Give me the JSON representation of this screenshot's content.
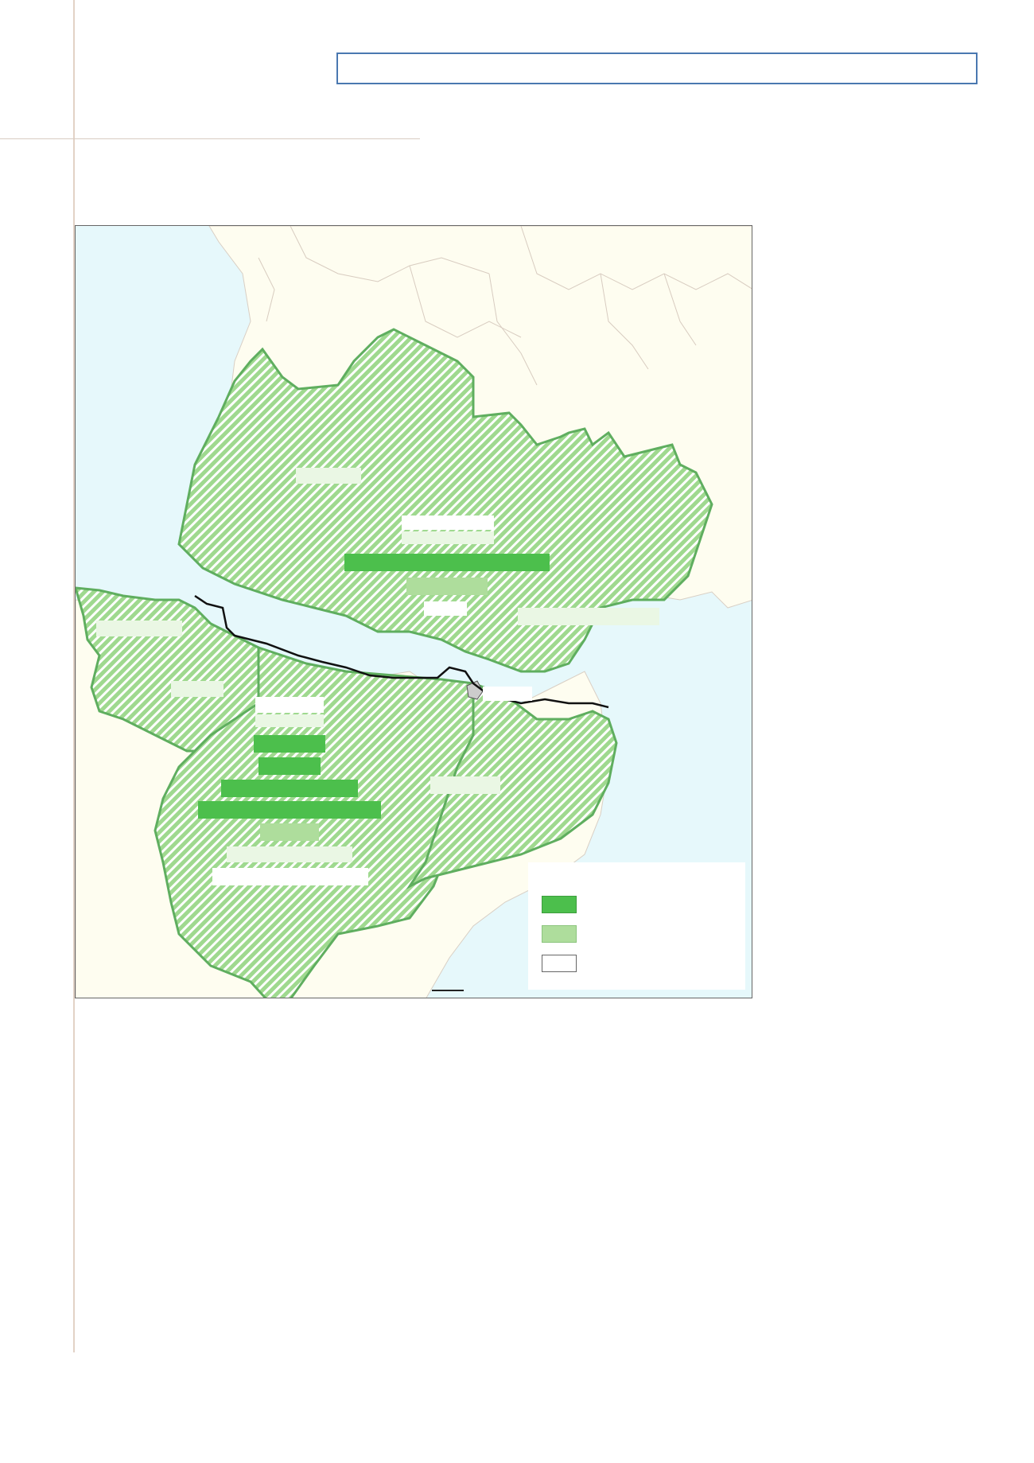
{
  "page": {
    "title": ""
  },
  "colors": {
    "sea": "#e6f8fb",
    "land_outside": "#fefdf0",
    "region_fill": "#9fd98f",
    "region_hatch": "#ffffff",
    "region_border": "#5fae5f",
    "border_line": "#111111",
    "andorra": "#cccccc",
    "legend_high": "#4cbf4c",
    "legend_mid": "#aedd9c",
    "legend_low": "#ffffff",
    "title_border": "#4a78b0"
  },
  "map": {
    "labels": [
      {
        "id": "label-gironde",
        "style": "pale"
      },
      {
        "id": "label-dordogne",
        "style": "white"
      },
      {
        "id": "label-lot-garonne",
        "style": "white"
      },
      {
        "id": "label-toulouse-main",
        "style": "high"
      },
      {
        "id": "label-toulouse-sub",
        "style": "mid"
      },
      {
        "id": "label-tarn",
        "style": "white"
      },
      {
        "id": "label-herault",
        "style": "pale"
      },
      {
        "id": "label-gipuzkoa",
        "style": "pale"
      },
      {
        "id": "label-navarra",
        "style": "pale"
      },
      {
        "id": "label-andorra",
        "style": "white"
      },
      {
        "id": "label-huesca-1",
        "style": "white"
      },
      {
        "id": "label-huesca-2",
        "style": "pale"
      },
      {
        "id": "label-aragon-1",
        "style": "high"
      },
      {
        "id": "label-aragon-2",
        "style": "high"
      },
      {
        "id": "label-aragon-3",
        "style": "high"
      },
      {
        "id": "label-aragon-4",
        "style": "high"
      },
      {
        "id": "label-aragon-5",
        "style": "mid"
      },
      {
        "id": "label-teruel-1",
        "style": "pale"
      },
      {
        "id": "label-teruel-2",
        "style": "white"
      },
      {
        "id": "label-catalunya",
        "style": "pale"
      }
    ]
  },
  "legend": {
    "items": [
      {
        "id": "high",
        "label": ""
      },
      {
        "id": "mid",
        "label": ""
      },
      {
        "id": "low",
        "label": ""
      }
    ]
  }
}
